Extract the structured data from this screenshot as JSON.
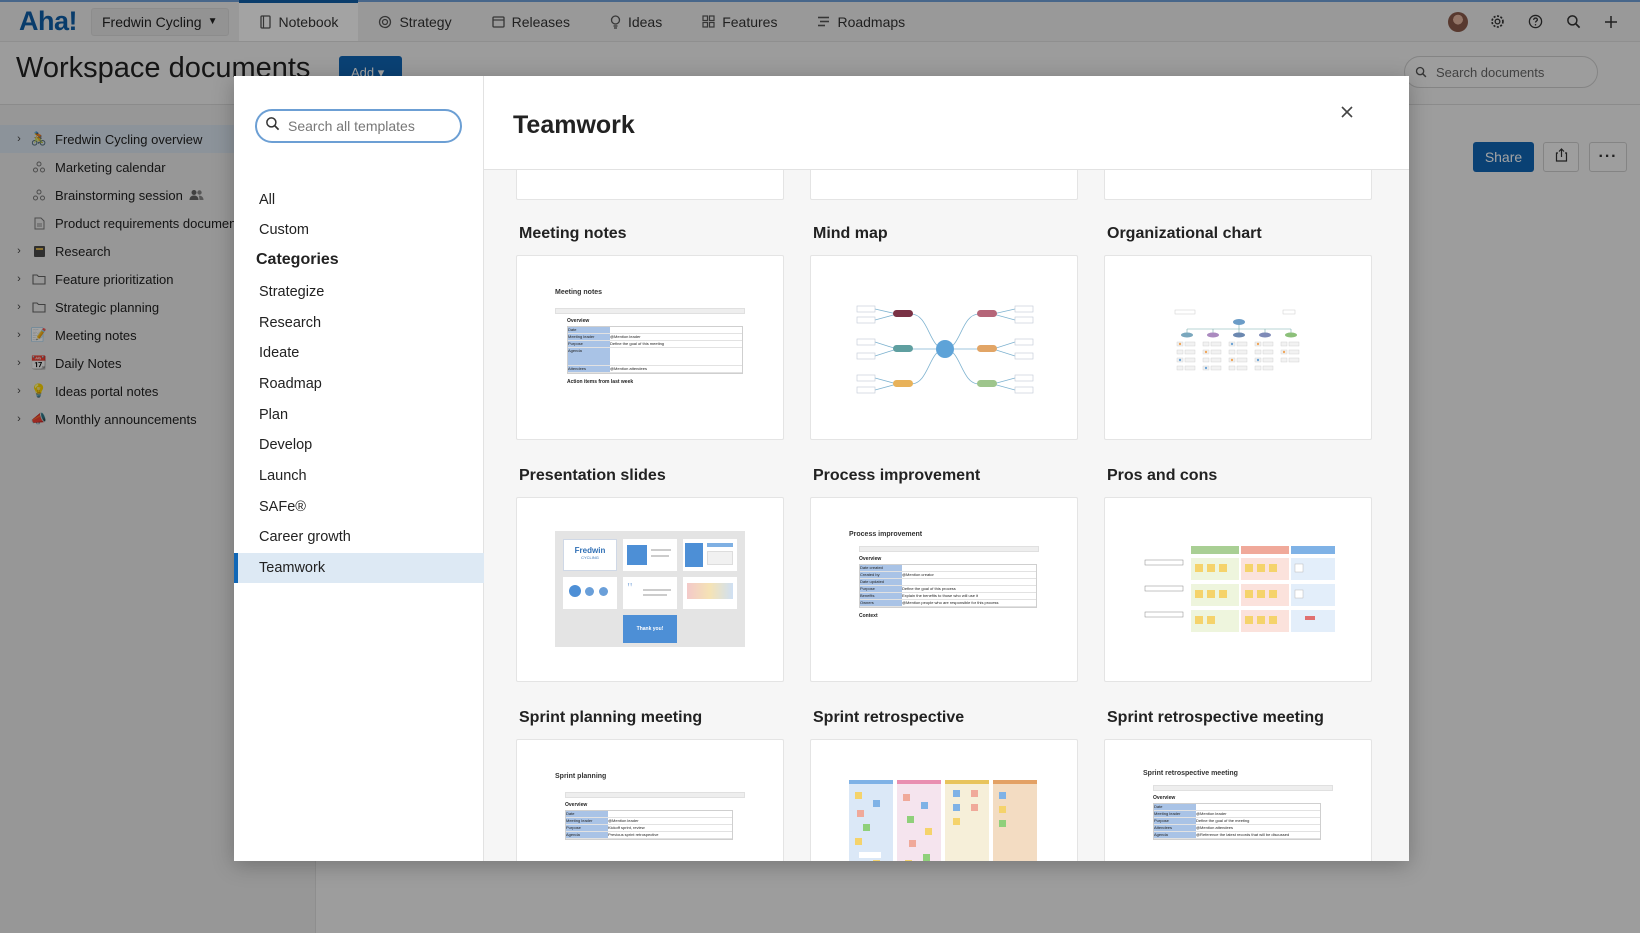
{
  "nav": {
    "logo": "Aha!",
    "workspace": "Fredwin Cycling",
    "tabs": [
      {
        "label": "Notebook",
        "icon": "notebook-icon",
        "active": true
      },
      {
        "label": "Strategy",
        "icon": "target-icon",
        "active": false
      },
      {
        "label": "Releases",
        "icon": "calendar-icon",
        "active": false
      },
      {
        "label": "Ideas",
        "icon": "lightbulb-icon",
        "active": false
      },
      {
        "label": "Features",
        "icon": "grid-icon",
        "active": false
      },
      {
        "label": "Roadmaps",
        "icon": "roadmap-icon",
        "active": false
      }
    ],
    "right_icons": [
      "avatar",
      "gear-icon",
      "help-icon",
      "search-icon",
      "plus-icon"
    ]
  },
  "page": {
    "title": "Workspace documents",
    "add_label": "Add",
    "search_placeholder": "Search documents",
    "share_label": "Share"
  },
  "tree": [
    {
      "label": "Fredwin Cycling overview",
      "icon": "bicycle-icon",
      "expandable": true,
      "selected": true
    },
    {
      "label": "Marketing calendar",
      "icon": "whiteboard-icon",
      "expandable": false
    },
    {
      "label": "Brainstorming session",
      "icon": "whiteboard-icon",
      "expandable": false,
      "shared": true
    },
    {
      "label": "Product requirements document",
      "icon": "document-icon",
      "expandable": false
    },
    {
      "label": "Research",
      "icon": "book-icon",
      "expandable": true
    },
    {
      "label": "Feature prioritization",
      "icon": "folder-icon",
      "expandable": true
    },
    {
      "label": "Strategic planning",
      "icon": "folder-icon",
      "expandable": true
    },
    {
      "label": "Meeting notes",
      "icon": "memo-icon",
      "expandable": true
    },
    {
      "label": "Daily Notes",
      "icon": "calendar-icon",
      "expandable": true
    },
    {
      "label": "Ideas portal notes",
      "icon": "lightbulb-icon",
      "expandable": true
    },
    {
      "label": "Monthly announcements",
      "icon": "megaphone-icon",
      "expandable": true
    }
  ],
  "modal": {
    "search_placeholder": "Search all templates",
    "title": "Teamwork",
    "filters": [
      "All",
      "Custom"
    ],
    "categories_heading": "Categories",
    "categories": [
      "Strategize",
      "Research",
      "Ideate",
      "Roadmap",
      "Plan",
      "Develop",
      "Launch",
      "SAFe®",
      "Career growth",
      "Teamwork"
    ],
    "active_category": "Teamwork",
    "templates": [
      {
        "title": "Meeting notes",
        "kind": "doc"
      },
      {
        "title": "Mind map",
        "kind": "mindmap"
      },
      {
        "title": "Organizational chart",
        "kind": "orgchart"
      },
      {
        "title": "Presentation slides",
        "kind": "slides"
      },
      {
        "title": "Process improvement",
        "kind": "doc"
      },
      {
        "title": "Pros and cons",
        "kind": "proscons"
      },
      {
        "title": "Sprint planning meeting",
        "kind": "doc"
      },
      {
        "title": "Sprint retrospective",
        "kind": "retro"
      },
      {
        "title": "Sprint retrospective meeting",
        "kind": "doc"
      }
    ],
    "thumb_text": {
      "meeting_notes": {
        "title": "Meeting notes",
        "section": "Overview",
        "rows": [
          "Date",
          "Meeting leader",
          "Purpose",
          "Agenda",
          "Attendees"
        ],
        "values": [
          "@Mention leader",
          "Define the goal of this meeting",
          "",
          "",
          "@Mention attendees"
        ],
        "footer": "Action items from last week"
      },
      "process_improvement": {
        "title": "Process improvement",
        "section": "Overview",
        "rows": [
          "Date created",
          "Created by",
          "Date updated",
          "Purpose",
          "Benefits",
          "Owners"
        ],
        "values": [
          "",
          "@Mention creator",
          "",
          "Define the goal of this process",
          "Explain the benefits to those who will use it",
          "@Mention people who are responsible for this process"
        ],
        "footer": "Context"
      },
      "sprint_planning": {
        "title": "Sprint planning",
        "section": "Overview",
        "rows": [
          "Date",
          "Meeting leader",
          "Purpose",
          "Agenda"
        ],
        "values": [
          "",
          "@Mention leader",
          "Kickoff sprint, review",
          "Previous sprint retrospective"
        ],
        "footer": ""
      },
      "sprint_retro_meeting": {
        "title": "Sprint retrospective meeting",
        "section": "Overview",
        "rows": [
          "Date",
          "Meeting leader",
          "Purpose",
          "Attendees",
          "Agenda"
        ],
        "values": [
          "",
          "@Mention leader",
          "Define the goal of the meeting",
          "@Mention attendees",
          "@Reference the latest records that will be discussed"
        ],
        "footer": ""
      },
      "slides_brand": "Fredwin",
      "slides_sub": "CYCLING",
      "slides_cta": "Thank you!"
    }
  }
}
